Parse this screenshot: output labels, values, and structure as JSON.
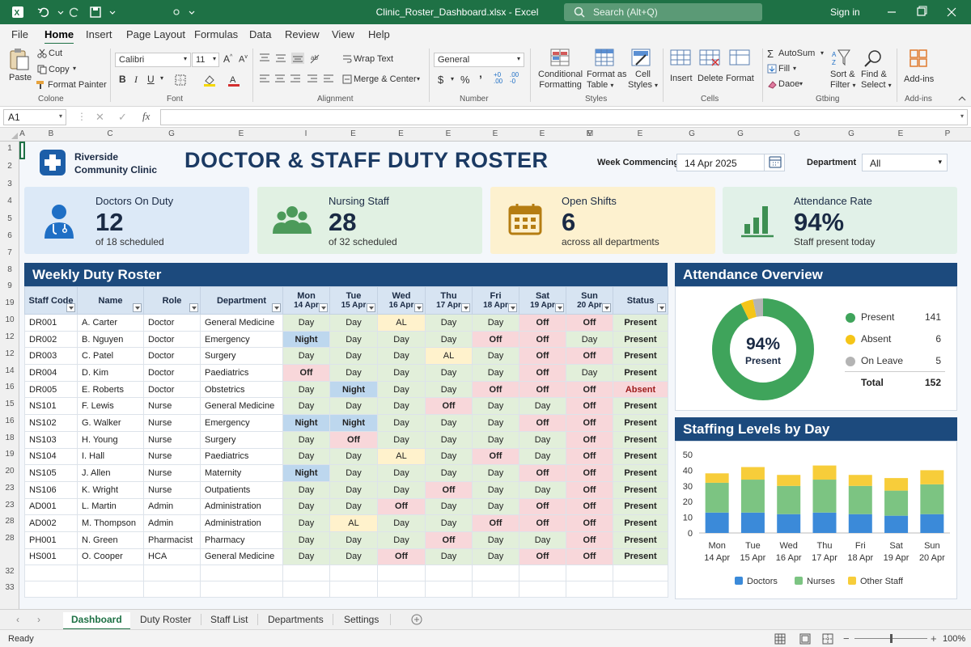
{
  "window": {
    "title": "Clinic_Roster_Dashboard.xlsx - Excel",
    "search_placeholder": "Search (Alt+Q)",
    "signin": "Sign in"
  },
  "menu": [
    "File",
    "Home",
    "Insert",
    "Page Layout",
    "Formulas",
    "Data",
    "Review",
    "View",
    "Help"
  ],
  "ribbon": {
    "paste": "Paste",
    "cut": "Cut",
    "copy": "Copy",
    "format_painter": "Format Painter",
    "clipboard_label": "Colone",
    "font_name": "Calibri",
    "font_size": "11",
    "font_label": "Font",
    "wrap_text": "Wrap Text",
    "merge_center": "Merge & Center",
    "alignment_label": "Alignment",
    "number_format": "General",
    "number_label": "Number",
    "cond_format": [
      "Conditional",
      "Formatting"
    ],
    "format_table": [
      "Format as",
      "Table"
    ],
    "cell_styles": [
      "Cell",
      "Styles"
    ],
    "styles_label": "Styles",
    "insert": "Insert",
    "delete": "Delete",
    "format": "Format",
    "cells_label": "Cells",
    "autosum": "AutoSum",
    "fill": "Fill",
    "clear": "Daoe",
    "sort_filter": [
      "Sort &",
      "Filter"
    ],
    "find_select": [
      "Find &",
      "Select"
    ],
    "editing_label": "Gtbing",
    "addins": "Add-ins",
    "addins_label": "Add-ins"
  },
  "formula_bar": {
    "name_box": "A1",
    "content": ""
  },
  "columns": [
    "A",
    "B",
    "C",
    "D",
    "E",
    "F",
    "G",
    "H",
    "I",
    "J",
    "K",
    "L",
    "M",
    "N",
    "O",
    "P"
  ],
  "col_headers_shown": [
    "A",
    "B",
    "C",
    "G",
    "E",
    "I",
    "E",
    "E",
    "E",
    "E",
    "E",
    "E",
    "M",
    "E",
    "G",
    "G",
    "G",
    "G",
    "E",
    "P"
  ],
  "row_numbers": [
    "1",
    "2",
    "3",
    "4",
    "5",
    "6",
    "7",
    "8",
    "9",
    "19",
    "10",
    "12",
    "12",
    "14",
    "16",
    "15",
    "16",
    "18",
    "19",
    "20",
    "23",
    "23",
    "28",
    "28",
    "32",
    "33"
  ],
  "header": {
    "clinic_line1": "Riverside",
    "clinic_line2": "Community Clinic",
    "title": "DOCTOR & STAFF DUTY ROSTER",
    "week_label": "Week Commencing",
    "week_value": "14 Apr 2025",
    "dept_label": "Department",
    "dept_value": "All"
  },
  "kpis": [
    {
      "title": "Doctors On Duty",
      "value": "12",
      "sub": "of 18 scheduled",
      "bg": "#dce9f7",
      "accent": "#1f6fc5",
      "icon": "doctor-icon"
    },
    {
      "title": "Nursing Staff",
      "value": "28",
      "sub": "of 32 scheduled",
      "bg": "#e1f1e3",
      "accent": "#4c9a5a",
      "icon": "staff-group-icon"
    },
    {
      "title": "Open Shifts",
      "value": "6",
      "sub": "across all departments",
      "bg": "#fdf1cf",
      "accent": "#b57d12",
      "icon": "calendar-icon"
    },
    {
      "title": "Attendance Rate",
      "value": "94%",
      "sub": "Staff present today",
      "bg": "#e1f1e8",
      "accent": "#3d8f52",
      "icon": "bar-chart-icon"
    }
  ],
  "roster": {
    "title": "Weekly Duty Roster",
    "columns": [
      {
        "l1": "Staff Code",
        "l2": ""
      },
      {
        "l1": "Name",
        "l2": ""
      },
      {
        "l1": "Role",
        "l2": ""
      },
      {
        "l1": "Department",
        "l2": ""
      },
      {
        "l1": "Mon",
        "l2": "14 Apr"
      },
      {
        "l1": "Tue",
        "l2": "15 Apr"
      },
      {
        "l1": "Wed",
        "l2": "16 Apr"
      },
      {
        "l1": "Thu",
        "l2": "17 Apr"
      },
      {
        "l1": "Fri",
        "l2": "18 Apr"
      },
      {
        "l1": "Sat",
        "l2": "19 Apr"
      },
      {
        "l1": "Sun",
        "l2": "20 Apr"
      },
      {
        "l1": "Status",
        "l2": ""
      }
    ],
    "rows": [
      [
        "DR001",
        "A. Carter",
        "Doctor",
        "General Medicine",
        "Day",
        "Day",
        "AL",
        "Day",
        "Day",
        "Off",
        "Off",
        "Present"
      ],
      [
        "DR002",
        "B. Nguyen",
        "Doctor",
        "Emergency",
        "Night",
        "Day",
        "Day",
        "Day",
        "Off",
        "Off",
        "Day",
        "Present"
      ],
      [
        "DR003",
        "C. Patel",
        "Doctor",
        "Surgery",
        "Day",
        "Day",
        "Day",
        "AL",
        "Day",
        "Off",
        "Off",
        "Present"
      ],
      [
        "DR004",
        "D. Kim",
        "Doctor",
        "Paediatrics",
        "Off",
        "Day",
        "Day",
        "Day",
        "Day",
        "Off",
        "Day",
        "Present"
      ],
      [
        "DR005",
        "E. Roberts",
        "Doctor",
        "Obstetrics",
        "Day",
        "Night",
        "Day",
        "Day",
        "Off",
        "Off",
        "Off",
        "Absent"
      ],
      [
        "NS101",
        "F. Lewis",
        "Nurse",
        "General Medicine",
        "Day",
        "Day",
        "Day",
        "Off",
        "Day",
        "Day",
        "Off",
        "Present"
      ],
      [
        "NS102",
        "G. Walker",
        "Nurse",
        "Emergency",
        "Night",
        "Night",
        "Day",
        "Day",
        "Day",
        "Off",
        "Off",
        "Present"
      ],
      [
        "NS103",
        "H. Young",
        "Nurse",
        "Surgery",
        "Day",
        "Off",
        "Day",
        "Day",
        "Day",
        "Day",
        "Off",
        "Present"
      ],
      [
        "NS104",
        "I. Hall",
        "Nurse",
        "Paediatrics",
        "Day",
        "Day",
        "AL",
        "Day",
        "Off",
        "Day",
        "Off",
        "Present"
      ],
      [
        "NS105",
        "J. Allen",
        "Nurse",
        "Maternity",
        "Night",
        "Day",
        "Day",
        "Day",
        "Day",
        "Off",
        "Off",
        "Present"
      ],
      [
        "NS106",
        "K. Wright",
        "Nurse",
        "Outpatients",
        "Day",
        "Day",
        "Day",
        "Off",
        "Day",
        "Day",
        "Off",
        "Present"
      ],
      [
        "AD001",
        "L. Martin",
        "Admin",
        "Administration",
        "Day",
        "Day",
        "Off",
        "Day",
        "Day",
        "Off",
        "Off",
        "Present"
      ],
      [
        "AD002",
        "M. Thompson",
        "Admin",
        "Administration",
        "Day",
        "AL",
        "Day",
        "Day",
        "Off",
        "Off",
        "Off",
        "Present"
      ],
      [
        "PH001",
        "N. Green",
        "Pharmacist",
        "Pharmacy",
        "Day",
        "Day",
        "Day",
        "Off",
        "Day",
        "Day",
        "Off",
        "Present"
      ],
      [
        "HS001",
        "O. Cooper",
        "HCA",
        "General Medicine",
        "Day",
        "Day",
        "Off",
        "Day",
        "Day",
        "Off",
        "Off",
        "Present"
      ]
    ]
  },
  "attendance": {
    "title": "Attendance Overview",
    "center_value": "94%",
    "center_label": "Present",
    "items": [
      {
        "name": "Present",
        "value": 141,
        "color": "#3fa45b"
      },
      {
        "name": "Absent",
        "value": 6,
        "color": "#f5c518"
      },
      {
        "name": "On Leave",
        "value": 5,
        "color": "#b4b4b4"
      }
    ],
    "total_label": "Total",
    "total_value": "152"
  },
  "chart_data": {
    "type": "bar",
    "title": "Staffing Levels by Day",
    "categories": [
      "Mon",
      "Tue",
      "Wed",
      "Thu",
      "Fri",
      "Sat",
      "Sun"
    ],
    "dates": [
      "14 Apr",
      "15 Apr",
      "16 Apr",
      "17 Apr",
      "18 Apr",
      "19 Apr",
      "20 Apr"
    ],
    "stacked": true,
    "ylim": [
      0,
      50
    ],
    "yticks": [
      0,
      10,
      20,
      30,
      40,
      50
    ],
    "legend": "bottom",
    "series": [
      {
        "name": "Doctors",
        "color": "#3b8ad9",
        "values": [
          13,
          13,
          12,
          13,
          12,
          11,
          12
        ]
      },
      {
        "name": "Nurses",
        "color": "#7cc482",
        "values": [
          19,
          21,
          18,
          21,
          18,
          16,
          19
        ]
      },
      {
        "name": "Other Staff",
        "color": "#f7cd3a",
        "values": [
          6,
          8,
          7,
          9,
          7,
          8,
          9
        ]
      }
    ]
  },
  "sheets": [
    "Dashboard",
    "Duty Roster",
    "Staff List",
    "Departments",
    "Settings"
  ],
  "status": {
    "ready": "Ready",
    "zoom": "100%"
  }
}
